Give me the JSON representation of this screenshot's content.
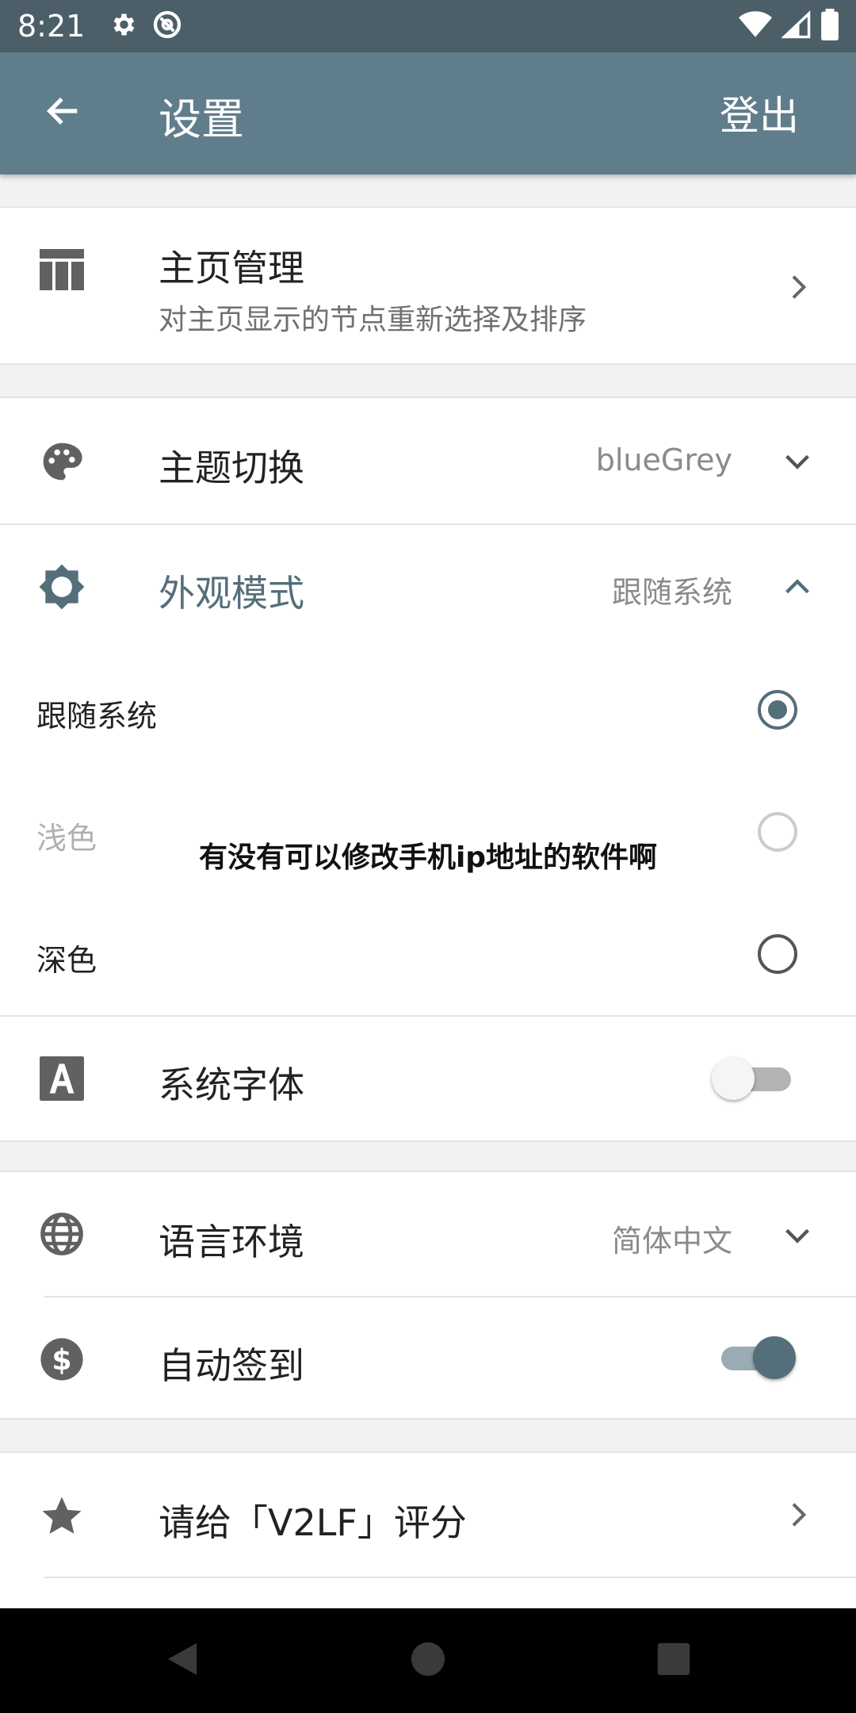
{
  "status_bar": {
    "time": "8:21",
    "icons_left": [
      "gear-icon",
      "at-sign-icon"
    ],
    "icons_right": [
      "wifi-icon",
      "signal-icon",
      "battery-icon"
    ]
  },
  "app_bar": {
    "title": "设置",
    "action": "登出",
    "back_icon": "arrow-left-icon"
  },
  "settings": {
    "home_manage": {
      "title": "主页管理",
      "subtitle": "对主页显示的节点重新选择及排序",
      "icon": "table-icon"
    },
    "theme": {
      "title": "主题切换",
      "value": "blueGrey",
      "icon": "palette-icon"
    },
    "appearance": {
      "title": "外观模式",
      "value": "跟随系统",
      "icon": "brightness-icon",
      "options": [
        {
          "label": "跟随系统",
          "selected": true,
          "disabled": false
        },
        {
          "label": "浅色",
          "selected": false,
          "disabled": true
        },
        {
          "label": "深色",
          "selected": false,
          "disabled": false
        }
      ]
    },
    "system_font": {
      "title": "系统字体",
      "enabled": false,
      "icon": "font-icon"
    },
    "language": {
      "title": "语言环境",
      "value": "简体中文",
      "icon": "globe-icon"
    },
    "auto_checkin": {
      "title": "自动签到",
      "enabled": true,
      "icon": "dollar-icon"
    },
    "rate": {
      "title": "请给「V2LF」评分",
      "icon": "star-icon"
    }
  },
  "watermark": "有没有可以修改手机ip地址的软件啊",
  "colors": {
    "status_bar": "#4c5f69",
    "app_bar": "#607d8b",
    "accent": "#546e7a"
  },
  "nav_bar": {
    "icons": [
      "back-triangle-icon",
      "home-circle-icon",
      "recents-square-icon"
    ]
  }
}
